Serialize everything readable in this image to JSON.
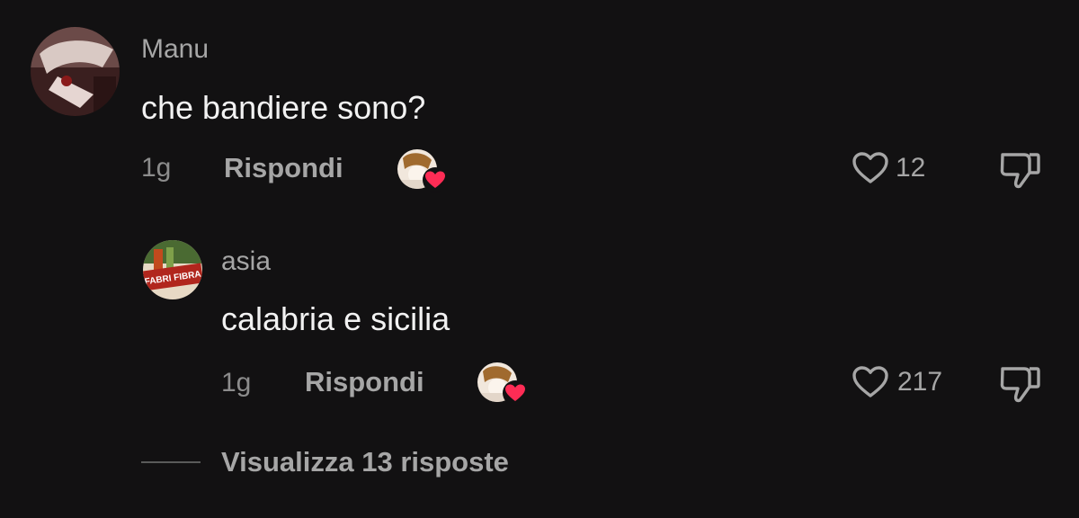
{
  "comments": [
    {
      "username": "Manu",
      "text": "che bandiere sono?",
      "time": "1g",
      "reply_label": "Rispondi",
      "likes": "12"
    },
    {
      "username": "asia",
      "text": "calabria e sicilia",
      "time": "1g",
      "reply_label": "Rispondi",
      "likes": "217",
      "avatar_text": "FABRI FIBRA"
    }
  ],
  "view_replies_label": "Visualizza 13 risposte",
  "colors": {
    "background": "#121112",
    "heart_badge": "#fe2c55",
    "muted_text": "#a6a6a6"
  }
}
